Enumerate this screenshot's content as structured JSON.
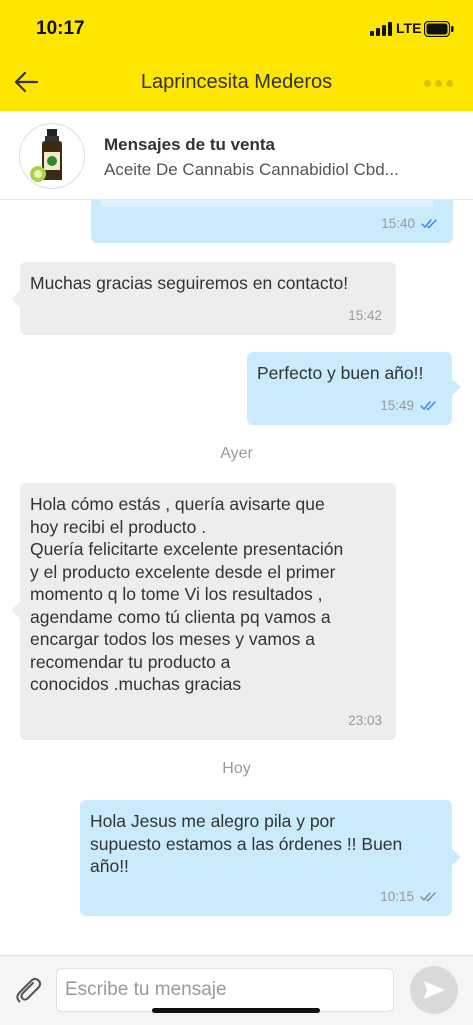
{
  "status_bar": {
    "time": "10:17",
    "network": "LTE"
  },
  "header": {
    "title": "Laprincesita Mederos"
  },
  "product": {
    "title": "Mensajes de tu venta",
    "subtitle": "Aceite De Cannabis Cannabidiol Cbd..."
  },
  "messages": [
    {
      "direction": "out",
      "text": "",
      "time": "15:40",
      "status": "read"
    },
    {
      "direction": "in",
      "text": "Muchas gracias seguiremos en contacto!",
      "time": "15:42"
    },
    {
      "direction": "out",
      "text": "Perfecto y buen año!!",
      "time": "15:49",
      "status": "read"
    },
    {
      "direction": "in",
      "text": "Hola cómo estás , quería avisarte que\nhoy recibi el producto .\nQuería felicitarte excelente presentación\ny el producto excelente desde el primer\nmomento q lo tome Vi los resultados ,\nagendame como tú clienta pq vamos a\nencargar todos los meses y vamos a\nrecomendar tu producto a\nconocidos .muchas gracias",
      "time": "23:03"
    },
    {
      "direction": "out",
      "text": "Hola Jesus me alegro pila y por\nsupuesto estamos a las órdenes !! Buen\naño!!",
      "time": "10:15",
      "status": "delivered"
    }
  ],
  "day_separators": {
    "yesterday": "Ayer",
    "today": "Hoy"
  },
  "composer": {
    "placeholder": "Escribe tu mensaje"
  },
  "colors": {
    "header_bg": "#FFE600",
    "incoming_bubble": "#EDEDED",
    "outgoing_bubble": "#C9EBFB",
    "read_check": "#3483FA"
  }
}
